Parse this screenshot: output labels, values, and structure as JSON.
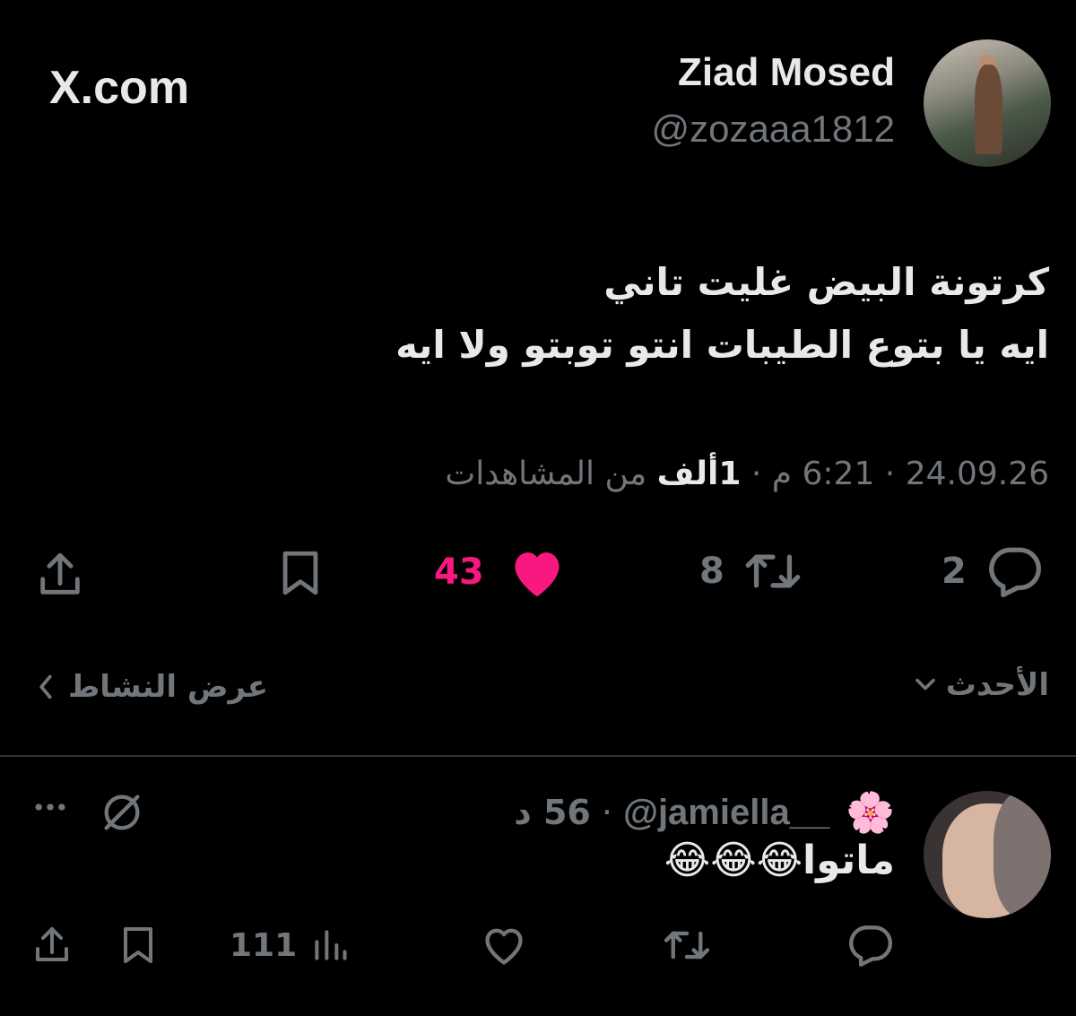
{
  "header": {
    "display_name": "Ziad Mosed",
    "handle": "@zozaaa1812",
    "site": "X.com"
  },
  "tweet": {
    "line1": "كرتونة البيض غليت تاني",
    "line2": "ايه يا بتوع الطيبات انتو توبتو ولا ايه",
    "meta": {
      "date": "24.09.26",
      "time": "6:21 م",
      "views_count": "1ألف",
      "views_label": "من المشاهدات"
    },
    "actions": {
      "replies": "2",
      "reposts": "8",
      "likes": "43"
    }
  },
  "filter": {
    "sort_label": "الأحدث",
    "activity_label": "عرض النشاط"
  },
  "reply": {
    "emoji": "🌸",
    "handle": "@jamiella__",
    "time": "56 د",
    "text": "ماتوا😂😂😂",
    "views": "111"
  },
  "colors": {
    "background": "#000000",
    "text": "#e7e9ea",
    "muted": "#71767b",
    "like": "#f91880",
    "divider": "#2f3336"
  }
}
